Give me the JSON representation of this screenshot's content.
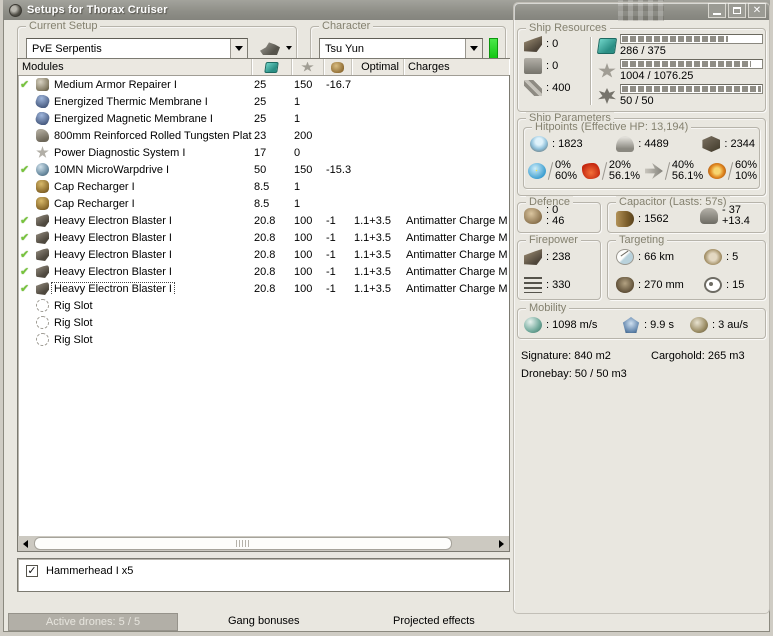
{
  "window": {
    "title": "Setups for Thorax Cruiser"
  },
  "setup": {
    "label": "Current Setup",
    "value": "PvE Serpentis"
  },
  "character": {
    "label": "Character",
    "value": "Tsu Yun"
  },
  "modules": {
    "headers": {
      "name": "Modules",
      "optimal": "Optimal",
      "charges": "Charges"
    },
    "header_icons": [
      "cpu-icon",
      "powergrid-icon",
      "capacitor-icon"
    ],
    "rows": [
      {
        "checked": true,
        "selected": false,
        "icon": "armor-repairer",
        "name": "Medium Armor Repairer I",
        "cpu": "25",
        "pg": "150",
        "cap": "-16.7",
        "optimal": "",
        "charges": ""
      },
      {
        "checked": false,
        "selected": false,
        "icon": "membrane",
        "name": "Energized Thermic Membrane I",
        "cpu": "25",
        "pg": "1",
        "cap": "",
        "optimal": "",
        "charges": ""
      },
      {
        "checked": false,
        "selected": false,
        "icon": "membrane",
        "name": "Energized Magnetic Membrane I",
        "cpu": "25",
        "pg": "1",
        "cap": "",
        "optimal": "",
        "charges": ""
      },
      {
        "checked": false,
        "selected": false,
        "icon": "plate",
        "name": "800mm Reinforced Rolled Tungsten Plat...",
        "cpu": "23",
        "pg": "200",
        "cap": "",
        "optimal": "",
        "charges": ""
      },
      {
        "checked": false,
        "selected": false,
        "icon": "pds",
        "name": "Power Diagnostic System I",
        "cpu": "17",
        "pg": "0",
        "cap": "",
        "optimal": "",
        "charges": ""
      },
      {
        "checked": true,
        "selected": false,
        "icon": "mwd",
        "name": "10MN MicroWarpdrive I",
        "cpu": "50",
        "pg": "150",
        "cap": "-15.3",
        "optimal": "",
        "charges": ""
      },
      {
        "checked": false,
        "selected": false,
        "icon": "cap-recharger",
        "name": "Cap Recharger I",
        "cpu": "8.5",
        "pg": "1",
        "cap": "",
        "optimal": "",
        "charges": ""
      },
      {
        "checked": false,
        "selected": false,
        "icon": "cap-recharger",
        "name": "Cap Recharger I",
        "cpu": "8.5",
        "pg": "1",
        "cap": "",
        "optimal": "",
        "charges": ""
      },
      {
        "checked": true,
        "selected": false,
        "icon": "blaster",
        "name": "Heavy Electron Blaster I",
        "cpu": "20.8",
        "pg": "100",
        "cap": "-1",
        "optimal": "1.1+3.5",
        "charges": "Antimatter Charge M"
      },
      {
        "checked": true,
        "selected": false,
        "icon": "blaster",
        "name": "Heavy Electron Blaster I",
        "cpu": "20.8",
        "pg": "100",
        "cap": "-1",
        "optimal": "1.1+3.5",
        "charges": "Antimatter Charge M"
      },
      {
        "checked": true,
        "selected": false,
        "icon": "blaster",
        "name": "Heavy Electron Blaster I",
        "cpu": "20.8",
        "pg": "100",
        "cap": "-1",
        "optimal": "1.1+3.5",
        "charges": "Antimatter Charge M"
      },
      {
        "checked": true,
        "selected": false,
        "icon": "blaster",
        "name": "Heavy Electron Blaster I",
        "cpu": "20.8",
        "pg": "100",
        "cap": "-1",
        "optimal": "1.1+3.5",
        "charges": "Antimatter Charge M"
      },
      {
        "checked": true,
        "selected": true,
        "icon": "blaster",
        "name": "Heavy Electron Blaster I",
        "cpu": "20.8",
        "pg": "100",
        "cap": "-1",
        "optimal": "1.1+3.5",
        "charges": "Antimatter Charge M"
      },
      {
        "checked": false,
        "selected": false,
        "icon": "rig",
        "name": "Rig Slot",
        "cpu": "",
        "pg": "",
        "cap": "",
        "optimal": "",
        "charges": ""
      },
      {
        "checked": false,
        "selected": false,
        "icon": "rig",
        "name": "Rig Slot",
        "cpu": "",
        "pg": "",
        "cap": "",
        "optimal": "",
        "charges": ""
      },
      {
        "checked": false,
        "selected": false,
        "icon": "rig",
        "name": "Rig Slot",
        "cpu": "",
        "pg": "",
        "cap": "",
        "optimal": "",
        "charges": ""
      }
    ]
  },
  "resources": {
    "label": "Ship Resources",
    "slots": [
      {
        "icon": "turret",
        "value": ": 0"
      },
      {
        "icon": "launcher",
        "value": ": 0"
      },
      {
        "icon": "calibration",
        "value": ": 400"
      }
    ],
    "bars": [
      {
        "icon": "cpu",
        "text": "286 / 375",
        "pct": 76
      },
      {
        "icon": "powergrid",
        "text": "1004 / 1076.25",
        "pct": 93
      },
      {
        "icon": "drone",
        "text": "50 / 50",
        "pct": 100
      }
    ]
  },
  "parameters": {
    "label": "Ship Parameters",
    "hitpoints": {
      "label": "Hitpoints (Effective HP: 13,194)",
      "values": [
        {
          "icon": "shield",
          "value": ": 1823"
        },
        {
          "icon": "armor",
          "value": ": 4489"
        },
        {
          "icon": "structure",
          "value": ": 2344"
        }
      ],
      "resists": [
        {
          "icon": "em",
          "top": "0%",
          "bottom": "60%"
        },
        {
          "icon": "thermal",
          "top": "20%",
          "bottom": "56.1%"
        },
        {
          "icon": "kinetic",
          "top": "40%",
          "bottom": "56.1%"
        },
        {
          "icon": "explosive",
          "top": "60%",
          "bottom": "10%"
        }
      ]
    },
    "defence": {
      "label": "Defence",
      "top": ": 0",
      "bottom": ": 46"
    },
    "capacitor": {
      "label": "Capacitor (Lasts: 57s)",
      "amount": ": 1562",
      "delta_top": "- 37",
      "delta_bottom": "+13.4"
    },
    "firepower": {
      "label": "Firepower",
      "dps": ": 238",
      "volley": ": 330"
    },
    "targeting": {
      "label": "Targeting",
      "range": ": 66 km",
      "max_targets": ": 5",
      "scan_res": ": 270 mm",
      "sensor_strength": ": 15"
    },
    "mobility": {
      "label": "Mobility",
      "speed": ": 1098 m/s",
      "align": ": 9.9 s",
      "warp": ": 3 au/s"
    },
    "signature": "Signature: 840 m2",
    "cargohold": "Cargohold: 265 m3",
    "dronebay": "Dronebay: 50 / 50 m3"
  },
  "drones": {
    "item": "Hammerhead I x5",
    "checked": true
  },
  "footer": {
    "active_tab": "Active drones: 5 / 5",
    "gang": "Gang bonuses",
    "projected": "Projected effects"
  },
  "colors": {
    "check_green": "#76c43a",
    "led_green": "#2ce62c",
    "cpu_teal": "#3aa79d",
    "bar_fill": "#8f8d85"
  }
}
